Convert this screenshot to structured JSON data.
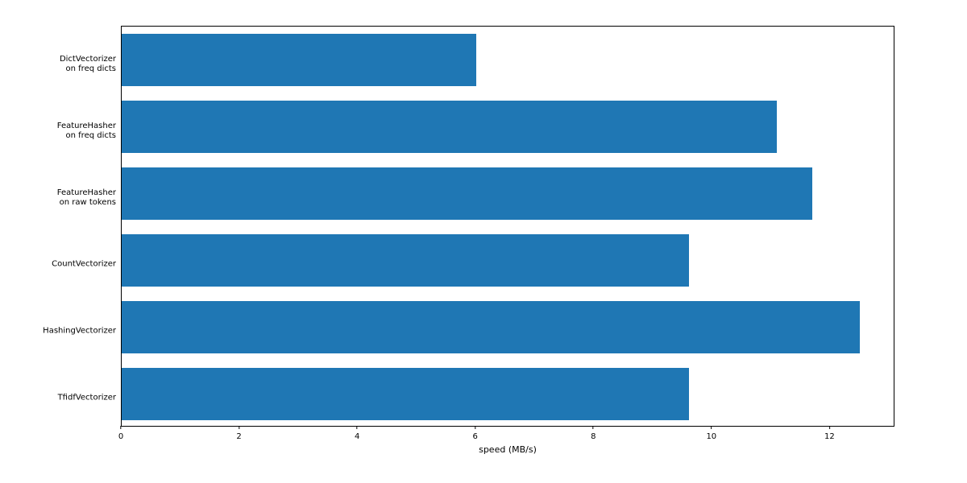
{
  "chart_data": {
    "type": "bar",
    "orientation": "horizontal",
    "categories": [
      "DictVectorizer\non freq dicts",
      "FeatureHasher\non freq dicts",
      "FeatureHasher\non raw tokens",
      "CountVectorizer",
      "HashingVectorizer",
      "TfidfVectorizer"
    ],
    "values": [
      6.0,
      11.1,
      11.7,
      9.6,
      12.5,
      9.6
    ],
    "xlabel": "speed (MB/s)",
    "ylabel": "",
    "title": "",
    "xlim": [
      0,
      13.1
    ],
    "xticks": [
      0,
      2,
      4,
      6,
      8,
      10,
      12
    ],
    "bar_color": "#1f77b4"
  }
}
